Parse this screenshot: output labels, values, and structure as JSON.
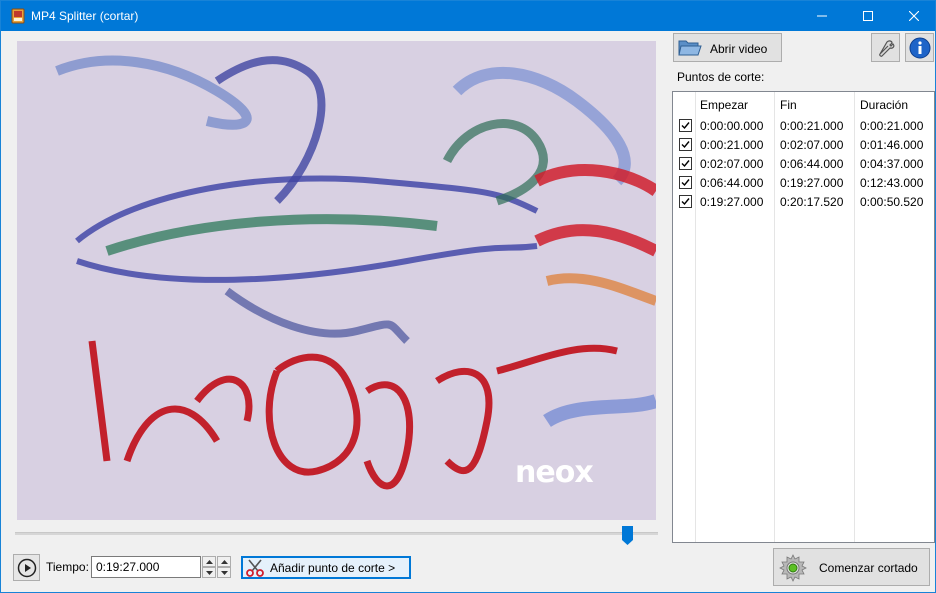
{
  "window": {
    "title": "MP4 Splitter (cortar)",
    "accent_color": "#0078d7",
    "controls": [
      "minimize-icon",
      "maximize-icon",
      "close-icon"
    ]
  },
  "video": {
    "watermark": "neox",
    "playback_position": 0.955
  },
  "toolbar": {
    "open_label": "Abrir video",
    "open_icon": "folder-open-icon",
    "settings_icon": "wrench-icon",
    "info_icon": "info-icon"
  },
  "cut_points": {
    "label": "Puntos de corte:",
    "columns": [
      "Empezar",
      "Fin",
      "Duración"
    ],
    "rows": [
      {
        "checked": true,
        "start": "0:00:00.000",
        "end": "0:00:21.000",
        "duration": "0:00:21.000"
      },
      {
        "checked": true,
        "start": "0:00:21.000",
        "end": "0:02:07.000",
        "duration": "0:01:46.000"
      },
      {
        "checked": true,
        "start": "0:02:07.000",
        "end": "0:06:44.000",
        "duration": "0:04:37.000"
      },
      {
        "checked": true,
        "start": "0:06:44.000",
        "end": "0:19:27.000",
        "duration": "0:12:43.000"
      },
      {
        "checked": true,
        "start": "0:19:27.000",
        "end": "0:20:17.520",
        "duration": "0:00:50.520"
      }
    ]
  },
  "controls": {
    "play_icon": "play-icon",
    "time_label": "Tiempo:",
    "time_value": "0:19:27.000",
    "add_cut_label": "Añadir punto de corte >",
    "add_cut_icon": "scissors-icon",
    "start_label": "Comenzar cortado",
    "start_icon": "gear-icon"
  }
}
